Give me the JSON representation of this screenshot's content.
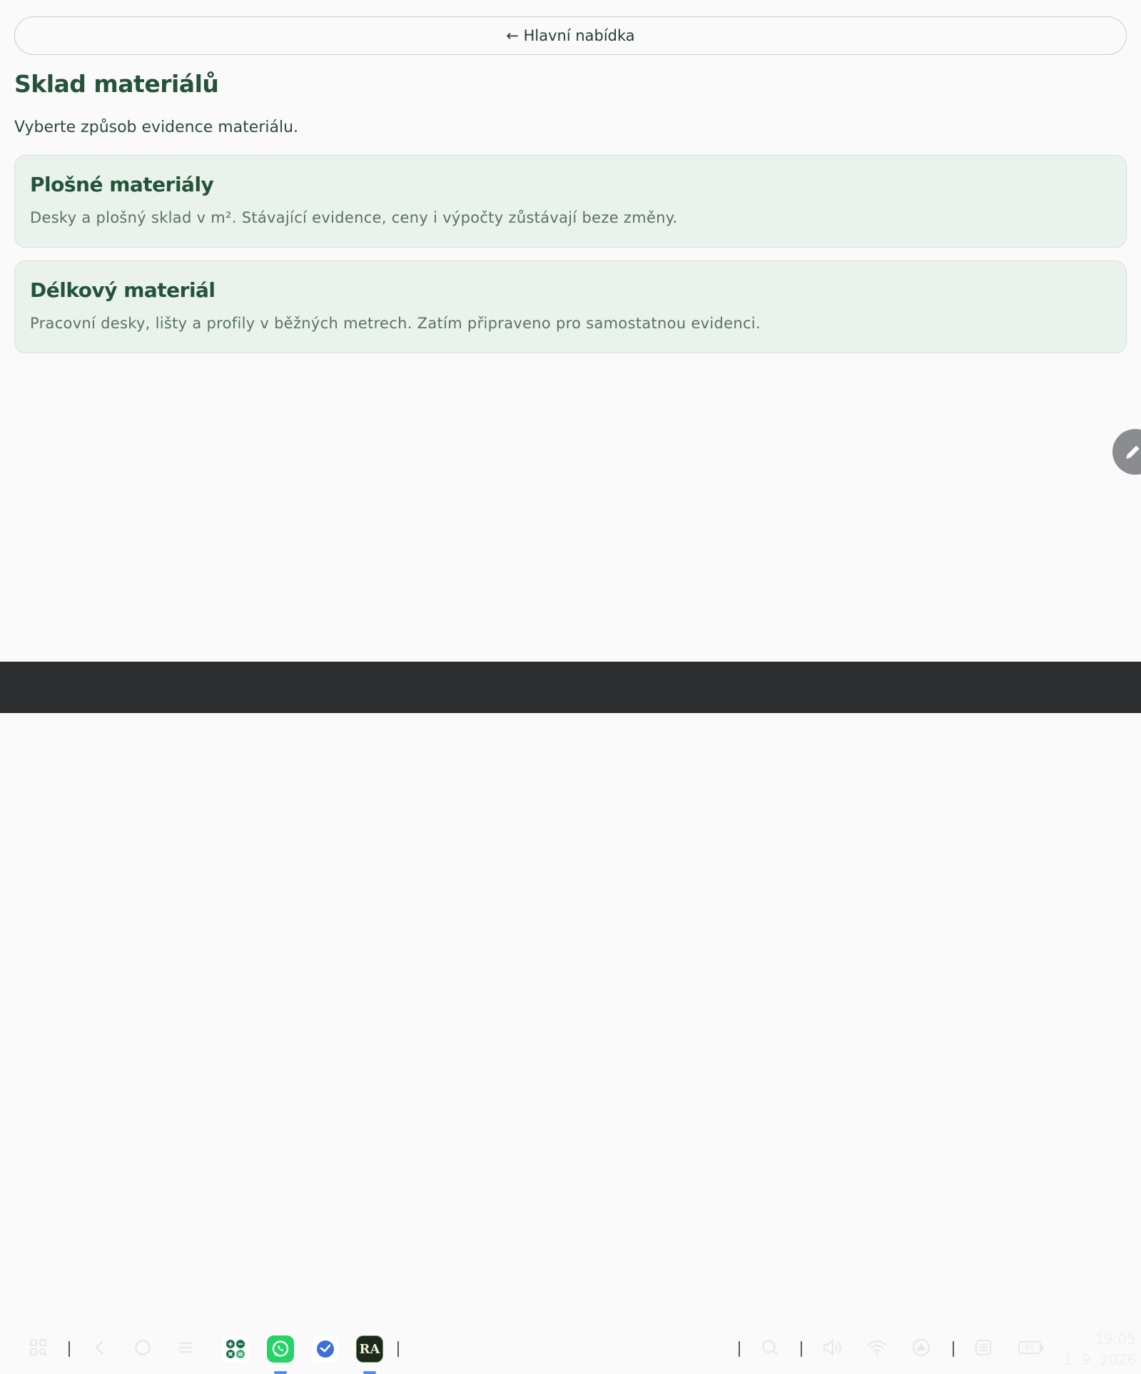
{
  "header": {
    "back_label": "← Hlavní nabídka"
  },
  "page": {
    "title": "Sklad materiálů",
    "subtitle": "Vyberte způsob evidence materiálu."
  },
  "options": [
    {
      "title": "Plošné materiály",
      "description": "Desky a plošný sklad v m². Stávající evidence, ceny i výpočty zůstávají beze změny."
    },
    {
      "title": "Délkový materiál",
      "description": "Pracovní desky, lišty a profily v běžných metrech. Zatím připraveno pro samostatnou evidenci."
    }
  ],
  "taskbar": {
    "left_icons": [
      "app-drawer-icon",
      "back-icon",
      "home-icon",
      "menu-icon"
    ],
    "apps": [
      {
        "name": "calculator-app-icon",
        "color": "#1f6f4a",
        "running": false
      },
      {
        "name": "whatsapp-app-icon",
        "color": "#25d366",
        "running": true
      },
      {
        "name": "clock-app-icon",
        "color": "#3e6fd8",
        "running": false
      },
      {
        "name": "ra-app-icon",
        "color": "#1b2a1c",
        "running": true
      }
    ],
    "app_ra_label": "RA",
    "tray_icons": [
      "search-icon",
      "volume-icon",
      "wifi-icon",
      "upload-icon",
      "notes-icon",
      "battery-icon"
    ],
    "battery_level": "61",
    "time": "19:05",
    "date": "1. 9. 2026"
  },
  "colors": {
    "accent": "#24533a",
    "card_bg": "#e9f3ec",
    "taskbar_bg": "#2c2d2f"
  }
}
